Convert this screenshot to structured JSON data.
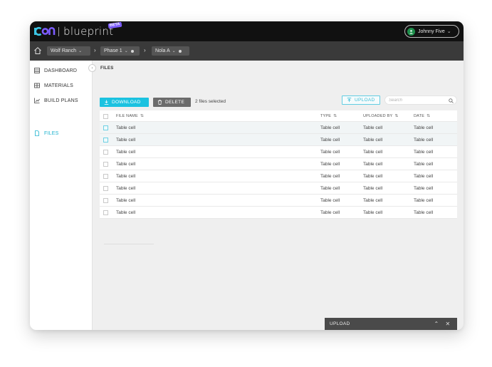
{
  "app": {
    "brand_logo_text": "icon",
    "product_name": "blueprint",
    "beta_label": "BETA",
    "user_name": "Johnny Five"
  },
  "breadcrumb": [
    {
      "label": "Wolf Ranch"
    },
    {
      "label": "Phase 1"
    },
    {
      "label": "Nola A"
    }
  ],
  "sidebar": {
    "items": [
      {
        "label": "DASHBOARD",
        "icon": "dashboard-icon"
      },
      {
        "label": "MATERIALS",
        "icon": "materials-icon"
      },
      {
        "label": "BUILD PLANS",
        "icon": "build-plans-icon"
      },
      {
        "label": "FILES",
        "icon": "file-icon",
        "active": true
      }
    ]
  },
  "main": {
    "title": "FILES",
    "download_label": "DOWNLOAD",
    "delete_label": "DELETE",
    "selected_text": "2 files selected",
    "upload_label": "UPLOAD",
    "search_placeholder": "Search"
  },
  "table": {
    "columns": [
      "FILE NAME",
      "TYPE",
      "UPLOADED BY",
      "DATE"
    ],
    "rows": [
      {
        "selected": true,
        "cells": [
          "Table cell",
          "Table cell",
          "Table cell",
          "Table cell"
        ]
      },
      {
        "selected": true,
        "cells": [
          "Table cell",
          "Table cell",
          "Table cell",
          "Table cell"
        ]
      },
      {
        "selected": false,
        "cells": [
          "Table cell",
          "Table cell",
          "Table cell",
          "Table cell"
        ]
      },
      {
        "selected": false,
        "cells": [
          "Table cell",
          "Table cell",
          "Table cell",
          "Table cell"
        ]
      },
      {
        "selected": false,
        "cells": [
          "Table cell",
          "Table cell",
          "Table cell",
          "Table cell"
        ]
      },
      {
        "selected": false,
        "cells": [
          "Table cell",
          "Table cell",
          "Table cell",
          "Table cell"
        ]
      },
      {
        "selected": false,
        "cells": [
          "Table cell",
          "Table cell",
          "Table cell",
          "Table cell"
        ]
      },
      {
        "selected": false,
        "cells": [
          "Table cell",
          "Table cell",
          "Table cell",
          "Table cell"
        ]
      }
    ]
  },
  "upload_panel": {
    "title": "UPLOAD"
  },
  "colors": {
    "accent": "#1bc2e0",
    "topbar": "#111111",
    "crumbbar": "#3a3a3a",
    "brand_purple": "#7c5cff",
    "brand_blue": "#3cc7e6"
  }
}
